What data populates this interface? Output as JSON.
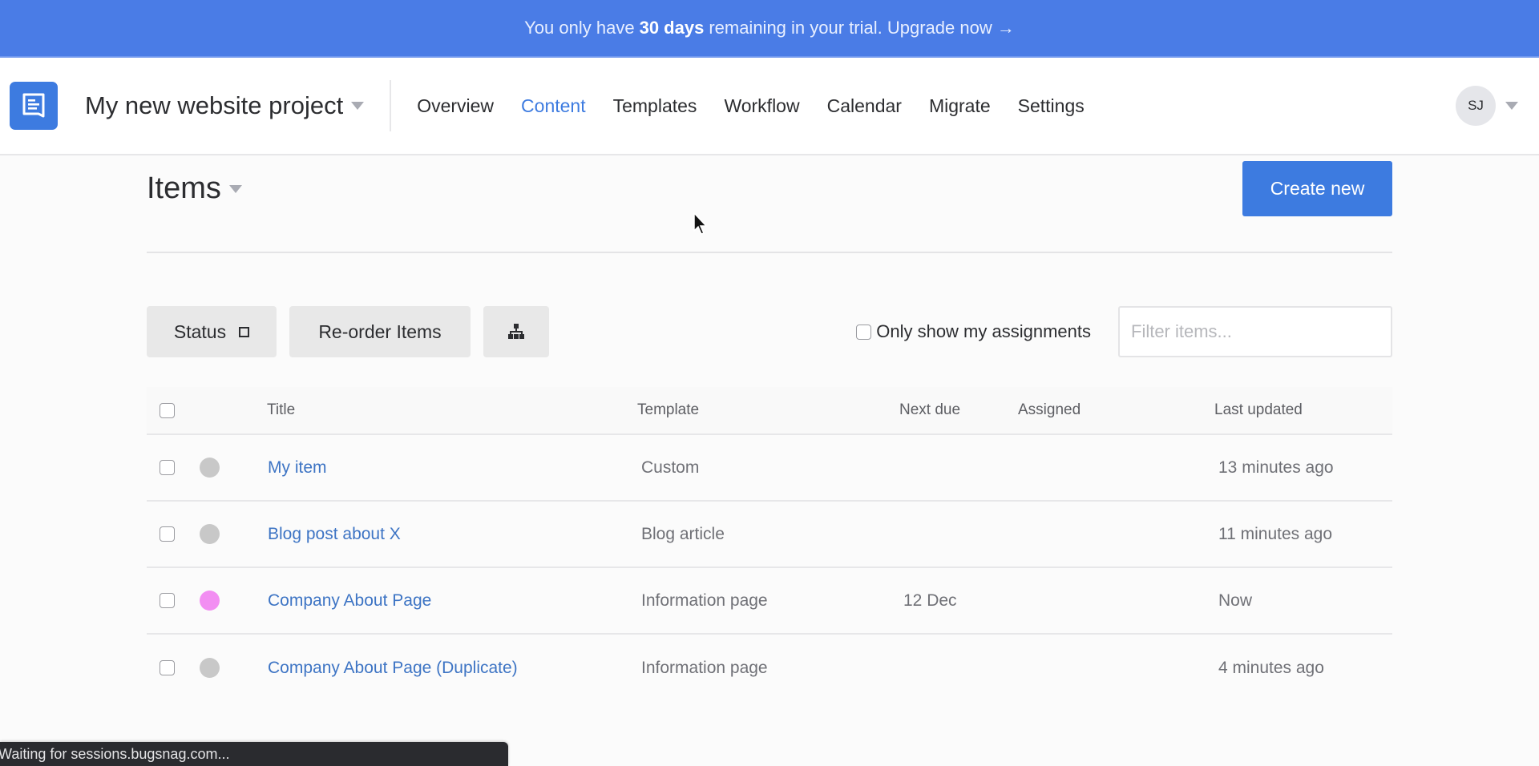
{
  "banner": {
    "prefix": "You only have",
    "highlight": "30 days",
    "suffix": "remaining in your trial. Upgrade now →"
  },
  "header": {
    "logo_icon": "chat-document-icon",
    "project_name": "My new website project",
    "nav": [
      {
        "label": "Overview",
        "active": false
      },
      {
        "label": "Content",
        "active": true
      },
      {
        "label": "Templates",
        "active": false
      },
      {
        "label": "Workflow",
        "active": false
      },
      {
        "label": "Calendar",
        "active": false
      },
      {
        "label": "Migrate",
        "active": false
      },
      {
        "label": "Settings",
        "active": false
      }
    ],
    "user_initials": "SJ"
  },
  "items": {
    "title": "Items",
    "create_label": "Create new",
    "toolbar": {
      "status_label": "Status",
      "reorder_label": "Re-order Items",
      "tree_icon": "hierarchy-icon",
      "assignments_label": "Only show my assignments",
      "assignments_checked": false,
      "filter_placeholder": "Filter items...",
      "filter_value": ""
    },
    "columns": {
      "title": "Title",
      "template": "Template",
      "next_due": "Next due",
      "assigned": "Assigned",
      "last_updated": "Last updated"
    },
    "rows": [
      {
        "status_color": "#c8c8c8",
        "title": "My item",
        "template": "Custom",
        "next_due": "",
        "assigned": "",
        "last_updated": "13 minutes ago"
      },
      {
        "status_color": "#c8c8c8",
        "title": "Blog post about X",
        "template": "Blog article",
        "next_due": "",
        "assigned": "",
        "last_updated": "11 minutes ago"
      },
      {
        "status_color": "#f28ef2",
        "title": "Company About Page",
        "template": "Information page",
        "next_due": "12 Dec",
        "assigned": "",
        "last_updated": "Now"
      },
      {
        "status_color": "#c8c8c8",
        "title": "Company About Page (Duplicate)",
        "template": "Information page",
        "next_due": "",
        "assigned": "",
        "last_updated": "4 minutes ago"
      }
    ]
  },
  "status_bar": {
    "text": "Waiting for sessions.bugsnag.com..."
  },
  "colors": {
    "accent": "#3d7be0",
    "banner": "#4a7ce6",
    "link": "#3d74c4"
  }
}
